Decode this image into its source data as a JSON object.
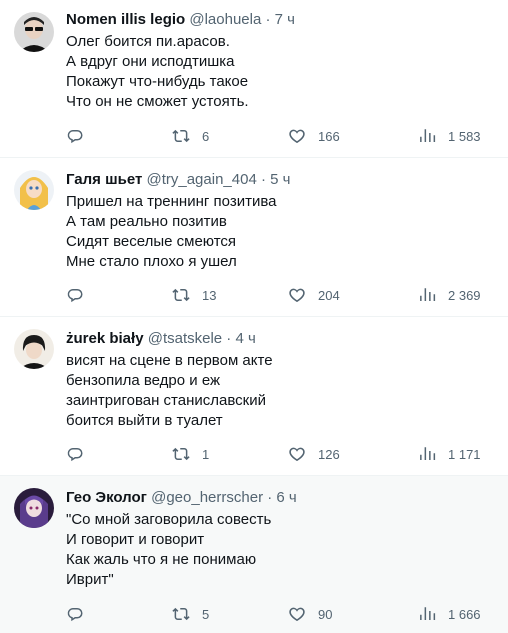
{
  "tweets": [
    {
      "name": "Nomen illis legio",
      "handle": "@laohuela",
      "sep": " · ",
      "time": "7 ч",
      "lines": [
        "Олег боится пи.арасов.",
        "А вдруг они исподтишка",
        "Покажут что-нибудь такое",
        "Что он не сможет устоять."
      ],
      "replies": "",
      "retweets": "6",
      "likes": "166",
      "views": "1 583"
    },
    {
      "name": "Галя шьет",
      "handle": "@try_again_404",
      "sep": " · ",
      "time": "5 ч",
      "lines": [
        "Пришел на треннинг позитива",
        "А там реально позитив",
        "Сидят веселые смеются",
        "Мне стало плохо я ушел"
      ],
      "replies": "",
      "retweets": "13",
      "likes": "204",
      "views": "2 369"
    },
    {
      "name": "żurek biały",
      "handle": "@tsatskele",
      "sep": " · ",
      "time": "4 ч",
      "lines": [
        "висят на сцене в первом акте",
        "бензопила ведро и еж",
        "заинтригован станиславский",
        "боится выйти в туалет"
      ],
      "replies": "",
      "retweets": "1",
      "likes": "126",
      "views": "1 171"
    },
    {
      "name": "Гео Эколог",
      "handle": "@geo_herrscher",
      "sep": " · ",
      "time": "6 ч",
      "lines": [
        "\"Со мной заговорила совесть",
        "И говорит и говорит",
        "Как жаль что я не понимаю",
        "Иврит\""
      ],
      "replies": "",
      "retweets": "5",
      "likes": "90",
      "views": "1 666"
    }
  ],
  "icons": {
    "reply": "reply-icon",
    "retweet": "retweet-icon",
    "like": "heart-icon",
    "views": "views-icon"
  },
  "colors": {
    "text": "#0f1419",
    "muted": "#536471",
    "divider": "#eff3f4",
    "shaded": "#f7f9f9"
  }
}
